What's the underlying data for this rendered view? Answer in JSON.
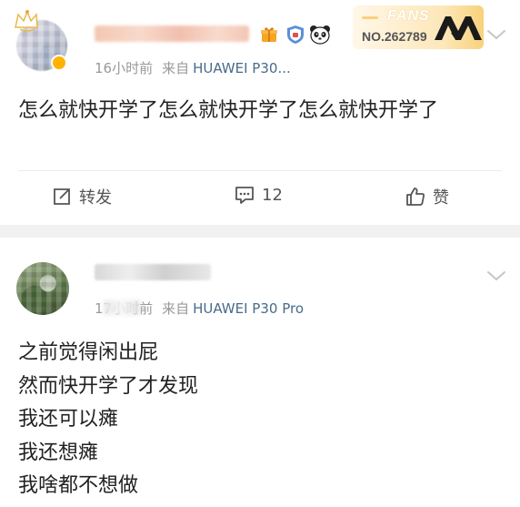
{
  "post1": {
    "time": "16小时前",
    "via_label": "来自",
    "device": "HUAWEI P30...",
    "fans_badge": {
      "label": "FANS",
      "number": "NO.262789"
    },
    "text": "怎么就快开学了怎么就快开学了怎么就快开学了",
    "actions": {
      "repost_label": "转发",
      "comment_count": "12",
      "like_label": "赞"
    }
  },
  "post2": {
    "time": "17小时前",
    "via_label": "来自",
    "device": "HUAWEI P30 Pro",
    "lines": [
      "之前觉得闲出屁",
      "然而快开学了才发现",
      "我还可以瘫",
      "我还想瘫",
      "我啥都不想做"
    ]
  },
  "icons": {
    "crown": "crown-deco-icon",
    "vip": "vip-badge-icon",
    "gift": "gift-icon",
    "shield": "shield-badge-icon",
    "panda": "panda-icon",
    "fans_logo": "fans-logo-icon",
    "chevron": "chevron-down-icon",
    "repost": "repost-icon",
    "comment": "comment-icon",
    "like": "thumbs-up-icon"
  },
  "colors": {
    "device_link": "#4a6a8a",
    "meta_gray": "#999999",
    "divider": "#ececec",
    "gap_band": "#f1f1f1",
    "fans_gold": "#f7d27a"
  }
}
